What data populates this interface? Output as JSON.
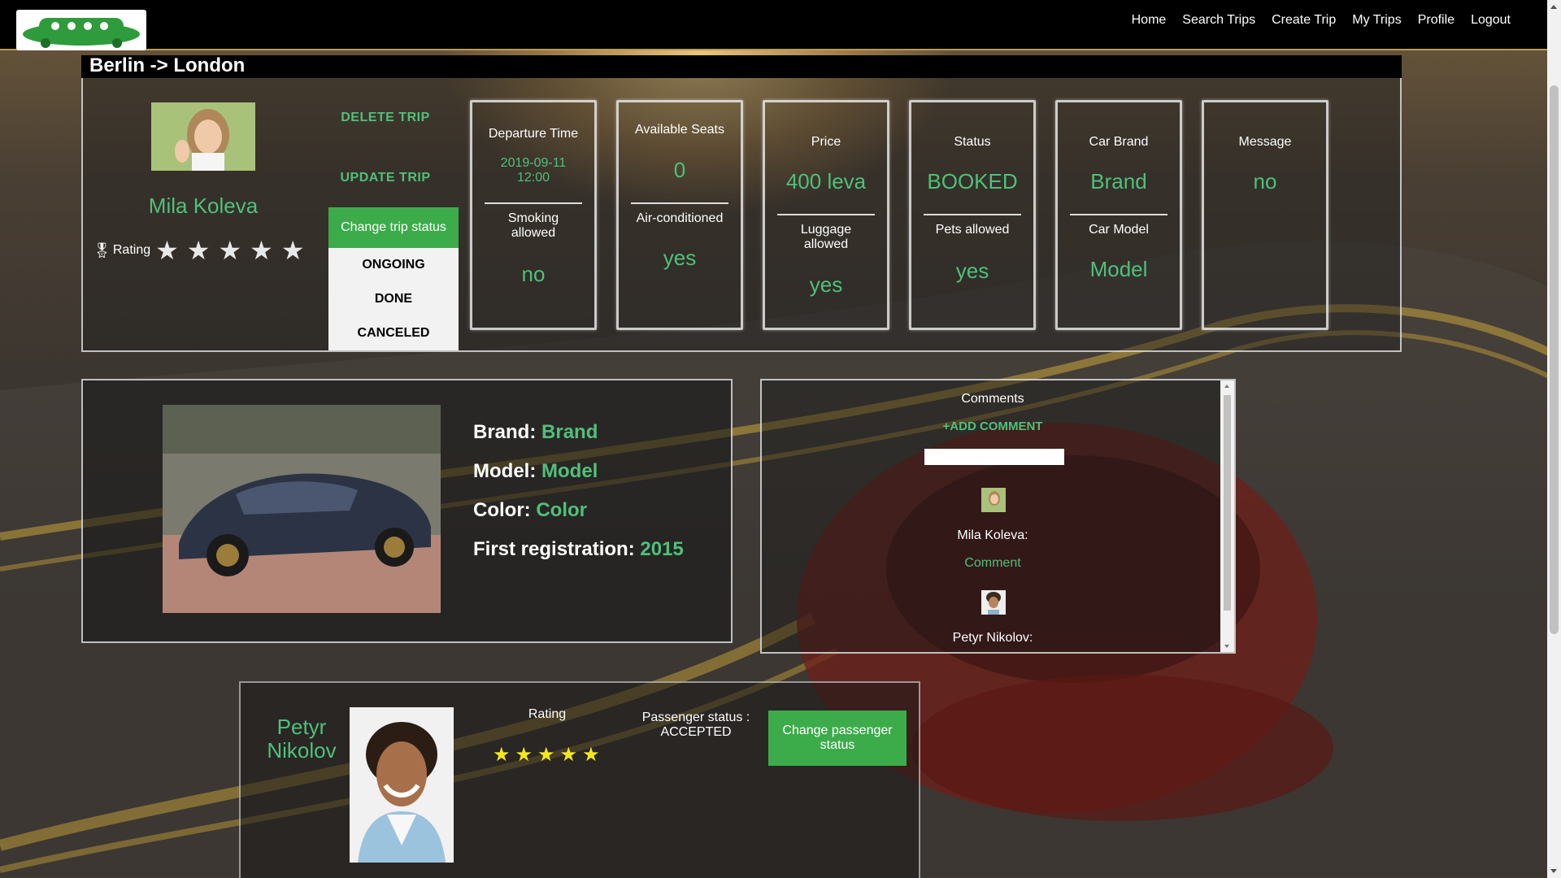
{
  "nav": {
    "brand_icon": "green-car-logo",
    "links": [
      "Home",
      "Search Trips",
      "Create Trip",
      "My Trips",
      "Profile",
      "Logout"
    ]
  },
  "trip": {
    "title": "Berlin -> London",
    "driver": {
      "name": "Mila Koleva",
      "rating_label": "Rating",
      "rating_stars": 5
    },
    "actions": {
      "delete": "DELETE TRIP",
      "update": "UPDATE TRIP"
    },
    "status_menu": {
      "label": "Change trip status",
      "options": [
        "ONGOING",
        "DONE",
        "CANCELED"
      ]
    },
    "cards": [
      {
        "top_label": "Departure Time",
        "top_value": "2019-09-11 12:00",
        "bottom_label": "Smoking allowed",
        "bottom_value": "no"
      },
      {
        "top_label": "Available Seats",
        "top_value": "0",
        "bottom_label": "Air-conditioned",
        "bottom_value": "yes"
      },
      {
        "top_label": "Price",
        "top_value": "400 leva",
        "bottom_label": "Luggage allowed",
        "bottom_value": "yes"
      },
      {
        "top_label": "Status",
        "top_value": "BOOKED",
        "bottom_label": "Pets allowed",
        "bottom_value": "yes"
      },
      {
        "top_label": "Car Brand",
        "top_value": "Brand",
        "bottom_label": "Car Model",
        "bottom_value": "Model"
      },
      {
        "top_label": "Message",
        "top_value": "no"
      }
    ]
  },
  "car": {
    "brand_label": "Brand:",
    "brand": "Brand",
    "model_label": "Model:",
    "model": "Model",
    "color_label": "Color:",
    "color": "Color",
    "registration_label": "First registration:",
    "registration": "2015"
  },
  "comments": {
    "title": "Comments",
    "add_label": "+ADD COMMENT",
    "input_value": "",
    "items": [
      {
        "author": "Mila Koleva:",
        "text": "Comment"
      },
      {
        "author": "Petyr Nikolov:",
        "text": ""
      }
    ]
  },
  "passenger": {
    "name_line1": "Petyr",
    "name_line2": "Nikolov",
    "rating_label": "Rating",
    "rating_stars": 5,
    "status_line1": "Passenger status :",
    "status_line2": "ACCEPTED",
    "button_label": "Change passenger status"
  },
  "colors": {
    "accent_green": "#4fc07a",
    "button_green": "#3cab4a",
    "star_yellow": "#f5e81a"
  }
}
